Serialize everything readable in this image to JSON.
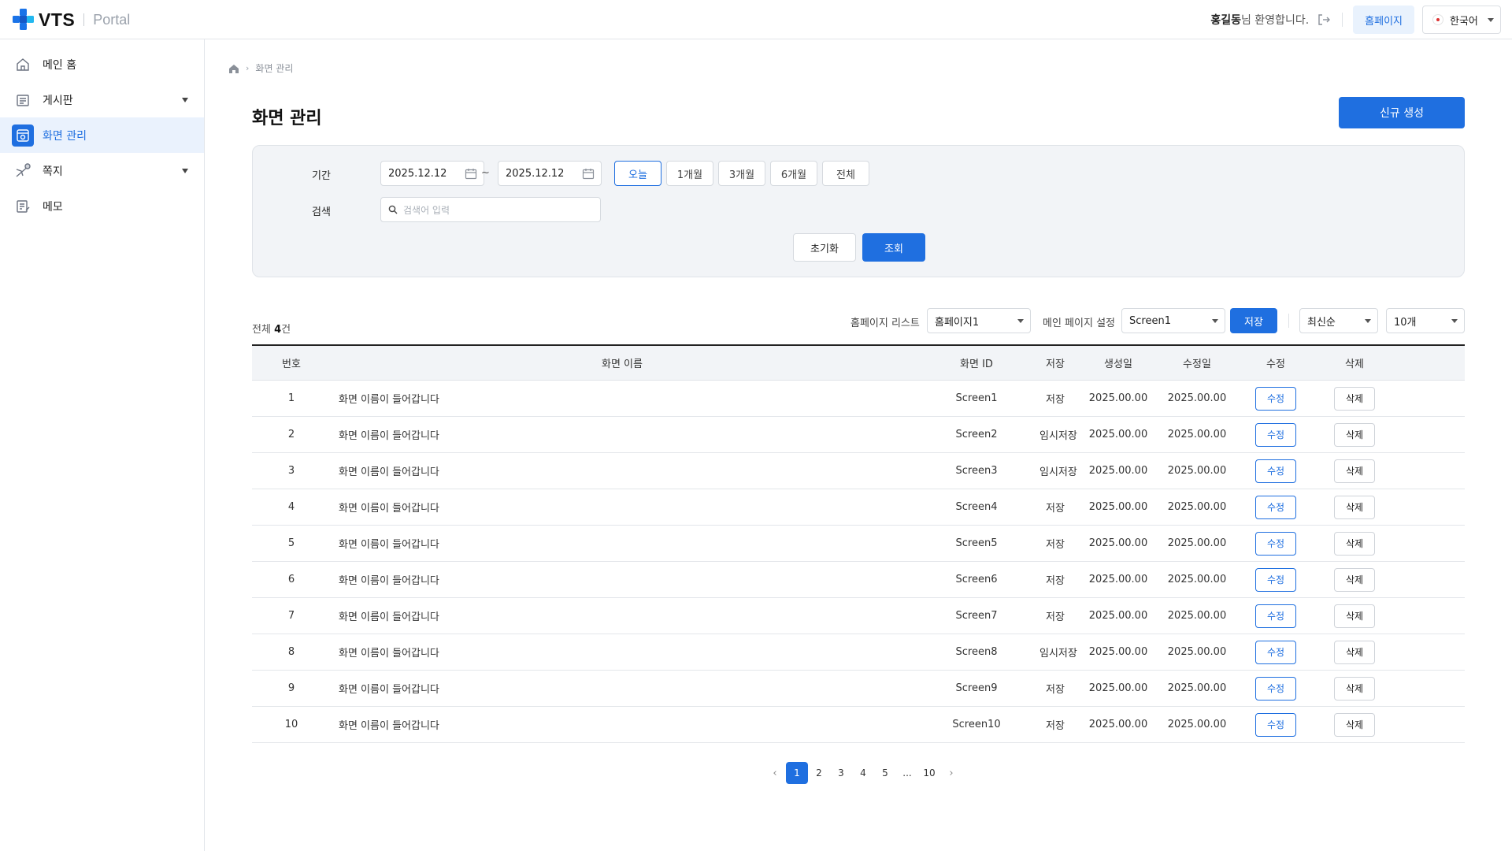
{
  "header": {
    "logo_text": "VTS",
    "logo_sub": "Portal",
    "user_name": "홍길동",
    "welcome_suffix": "님 환영합니다.",
    "homepage_label": "홈페이지",
    "language": "한국어"
  },
  "sidebar": {
    "items": [
      {
        "label": "메인 홈",
        "icon": "home-icon",
        "active": false,
        "expandable": false
      },
      {
        "label": "게시판",
        "icon": "board-icon",
        "active": false,
        "expandable": true
      },
      {
        "label": "화면 관리",
        "icon": "screen-icon",
        "active": true,
        "expandable": false
      },
      {
        "label": "쪽지",
        "icon": "message-icon",
        "active": false,
        "expandable": true
      },
      {
        "label": "메모",
        "icon": "memo-icon",
        "active": false,
        "expandable": false
      }
    ]
  },
  "breadcrumb": {
    "current": "화면 관리"
  },
  "page": {
    "title": "화면 관리",
    "new_button": "신규 생성"
  },
  "filter": {
    "period_label": "기간",
    "start_date": "2025.12.12",
    "end_date": "2025.12.12",
    "tilde": "~",
    "periods": [
      "오늘",
      "1개월",
      "3개월",
      "6개월",
      "전체"
    ],
    "selected_period": "오늘",
    "search_label": "검색",
    "search_placeholder": "검색어 입력",
    "reset_label": "초기화",
    "query_label": "조회"
  },
  "toolbar": {
    "total_prefix": "전체",
    "total_count": "4",
    "total_suffix": "건",
    "homepage_list_label": "홈페이지 리스트",
    "homepage_list_value": "홈페이지1",
    "main_page_label": "메인 페이지 설정",
    "main_page_value": "Screen1",
    "save_label": "저장",
    "sort_value": "최신순",
    "page_size_value": "10개"
  },
  "table": {
    "headers": {
      "no": "번호",
      "name": "화면 이름",
      "id": "화면 ID",
      "save": "저장",
      "created": "생성일",
      "modified": "수정일",
      "edit": "수정",
      "delete": "삭제"
    },
    "edit_label": "수정",
    "delete_label": "삭제",
    "rows": [
      {
        "no": "1",
        "name": "화면 이름이 들어갑니다",
        "id": "Screen1",
        "save": "저장",
        "created": "2025.00.00",
        "modified": "2025.00.00"
      },
      {
        "no": "2",
        "name": "화면 이름이 들어갑니다",
        "id": "Screen2",
        "save": "임시저장",
        "created": "2025.00.00",
        "modified": "2025.00.00"
      },
      {
        "no": "3",
        "name": "화면 이름이 들어갑니다",
        "id": "Screen3",
        "save": "임시저장",
        "created": "2025.00.00",
        "modified": "2025.00.00"
      },
      {
        "no": "4",
        "name": "화면 이름이 들어갑니다",
        "id": "Screen4",
        "save": "저장",
        "created": "2025.00.00",
        "modified": "2025.00.00"
      },
      {
        "no": "5",
        "name": "화면 이름이 들어갑니다",
        "id": "Screen5",
        "save": "저장",
        "created": "2025.00.00",
        "modified": "2025.00.00"
      },
      {
        "no": "6",
        "name": "화면 이름이 들어갑니다",
        "id": "Screen6",
        "save": "저장",
        "created": "2025.00.00",
        "modified": "2025.00.00"
      },
      {
        "no": "7",
        "name": "화면 이름이 들어갑니다",
        "id": "Screen7",
        "save": "저장",
        "created": "2025.00.00",
        "modified": "2025.00.00"
      },
      {
        "no": "8",
        "name": "화면 이름이 들어갑니다",
        "id": "Screen8",
        "save": "임시저장",
        "created": "2025.00.00",
        "modified": "2025.00.00"
      },
      {
        "no": "9",
        "name": "화면 이름이 들어갑니다",
        "id": "Screen9",
        "save": "저장",
        "created": "2025.00.00",
        "modified": "2025.00.00"
      },
      {
        "no": "10",
        "name": "화면 이름이 들어갑니다",
        "id": "Screen10",
        "save": "저장",
        "created": "2025.00.00",
        "modified": "2025.00.00"
      }
    ]
  },
  "pagination": {
    "prev": "‹",
    "next": "›",
    "pages": [
      "1",
      "2",
      "3",
      "4",
      "5",
      "...",
      "10"
    ],
    "current": "1"
  },
  "colors": {
    "accent": "#1f6fe0",
    "accent_light": "#eaf2fd",
    "logo_blue": "#1a73e8",
    "logo_cyan": "#22b8f0"
  }
}
